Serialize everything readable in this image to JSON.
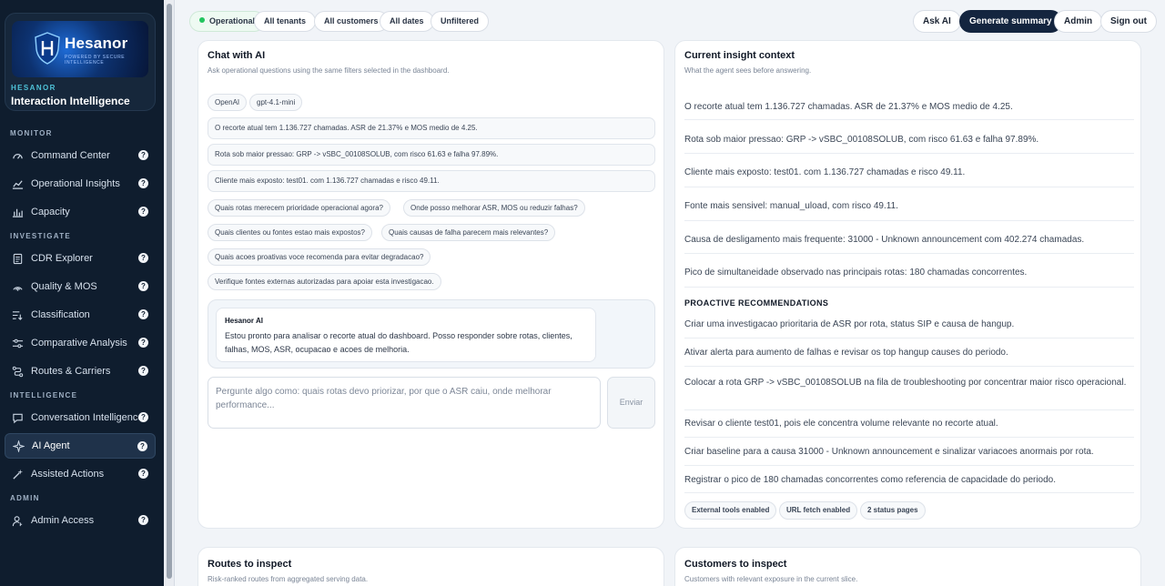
{
  "brand": {
    "logo_name": "Hesanor",
    "logo_tagline": "POWERED BY SECURE INTELLIGENCE",
    "kicker": "HESANOR",
    "title": "Interaction Intelligence"
  },
  "nav": {
    "sections": [
      {
        "label": "MONITOR",
        "items": [
          {
            "label": "Command Center",
            "icon": "gauge-icon"
          },
          {
            "label": "Operational Insights",
            "icon": "trend-line-icon"
          },
          {
            "label": "Capacity",
            "icon": "bar-chart-icon"
          }
        ]
      },
      {
        "label": "INVESTIGATE",
        "items": [
          {
            "label": "CDR Explorer",
            "icon": "document-icon"
          },
          {
            "label": "Quality & MOS",
            "icon": "signal-icon"
          },
          {
            "label": "Classification",
            "icon": "filter-list-icon"
          },
          {
            "label": "Comparative Analysis",
            "icon": "sliders-icon"
          },
          {
            "label": "Routes & Carriers",
            "icon": "route-icon"
          }
        ]
      },
      {
        "label": "INTELLIGENCE",
        "items": [
          {
            "label": "Conversation Intelligence",
            "icon": "chat-icon"
          },
          {
            "label": "AI Agent",
            "icon": "sparkle-icon",
            "active": true
          },
          {
            "label": "Assisted Actions",
            "icon": "wand-icon"
          }
        ]
      },
      {
        "label": "ADMIN",
        "items": [
          {
            "label": "Admin Access",
            "icon": "user-key-icon"
          }
        ]
      }
    ],
    "help_glyph": "?"
  },
  "topbar": {
    "status": "Operational",
    "filters": [
      "All tenants",
      "All customers",
      "All dates",
      "Unfiltered"
    ],
    "ask_ai": "Ask AI",
    "generate_summary": "Generate summary",
    "admin": "Admin",
    "sign_out": "Sign out",
    "status_color": "#22c55e"
  },
  "chat": {
    "title": "Chat with AI",
    "subtitle": "Ask operational questions using the same filters selected in the dashboard.",
    "provider": "OpenAI",
    "model": "gpt-4.1-mini",
    "context_lines": [
      "O recorte atual tem 1.136.727 chamadas. ASR de 21.37% e MOS medio de 4.25.",
      "Rota sob maior pressao: GRP -> vSBC_00108SOLUB, com risco 61.63 e falha 97.89%.",
      "Cliente mais exposto: test01. com 1.136.727 chamadas e risco 49.11."
    ],
    "suggestions": [
      "Quais rotas merecem prioridade operacional agora?",
      "Onde posso melhorar ASR, MOS ou reduzir falhas?",
      "Quais clientes ou fontes estao mais expostos?",
      "Quais causas de falha parecem mais relevantes?",
      "Quais acoes proativas voce recomenda para evitar degradacao?",
      "Verifique fontes externas autorizadas para apoiar esta investigacao."
    ],
    "message_author": "Hesanor AI",
    "message_text": "Estou pronto para analisar o recorte atual do dashboard. Posso responder sobre rotas, clientes, falhas, MOS, ASR, ocupacao e acoes de melhoria.",
    "input_placeholder": "Pergunte algo como: quais rotas devo priorizar, por que o ASR caiu, onde melhorar performance...",
    "send_label": "Enviar"
  },
  "insight": {
    "title": "Current insight context",
    "subtitle": "What the agent sees before answering.",
    "facts": [
      "O recorte atual tem 1.136.727 chamadas. ASR de 21.37% e MOS medio de 4.25.",
      "Rota sob maior pressao: GRP -> vSBC_00108SOLUB, com risco 61.63 e falha 97.89%.",
      "Cliente mais exposto: test01. com 1.136.727 chamadas e risco 49.11.",
      "Fonte mais sensivel: manual_uload, com risco 49.11.",
      "Causa de desligamento mais frequente: 31000 - Unknown announcement com 402.274 chamadas.",
      "Pico de simultaneidade observado nas principais rotas: 180 chamadas concorrentes."
    ],
    "recommendations_heading": "PROACTIVE RECOMMENDATIONS",
    "recommendations": [
      "Criar uma investigacao prioritaria de ASR por rota, status SIP e causa de hangup.",
      "Ativar alerta para aumento de falhas e revisar os top hangup causes do periodo.",
      "Colocar a rota GRP -> vSBC_00108SOLUB na fila de troubleshooting por concentrar maior risco operacional.",
      "Revisar o cliente test01, pois ele concentra volume relevante no recorte atual.",
      "Criar baseline para a causa 31000 - Unknown announcement e sinalizar variacoes anormais por rota.",
      "Registrar o pico de 180 chamadas concorrentes como referencia de capacidade do periodo."
    ],
    "tags": [
      "External tools enabled",
      "URL fetch enabled",
      "2 status pages"
    ]
  },
  "routes": {
    "title": "Routes to inspect",
    "subtitle": "Risk-ranked routes from aggregated serving data."
  },
  "customers": {
    "title": "Customers to inspect",
    "subtitle": "Customers with relevant exposure in the current slice."
  }
}
